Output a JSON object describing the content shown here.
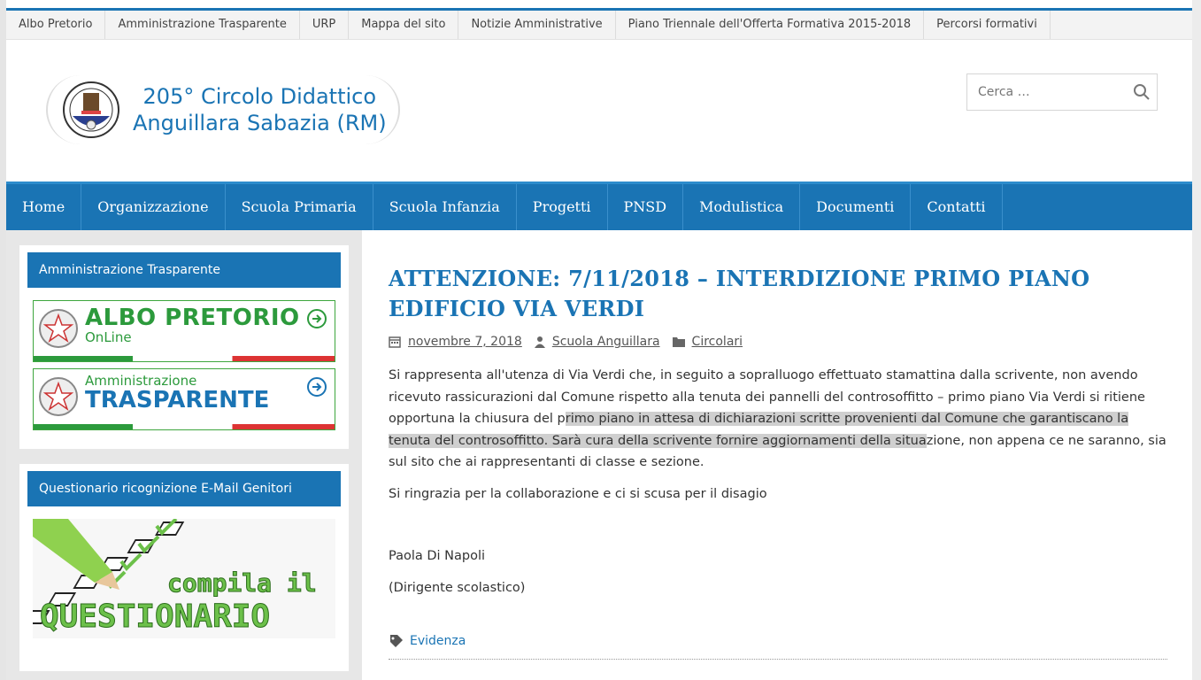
{
  "topnav": {
    "items": [
      "Albo Pretorio",
      "Amministrazione Trasparente",
      "URP",
      "Mappa del sito",
      "Notizie Amministrative",
      "Piano Triennale dell'Offerta Formativa 2015-2018",
      "Percorsi formativi"
    ]
  },
  "header": {
    "title_line1": "205° Circolo Didattico",
    "title_line2": "Anguillara Sabazia (RM)",
    "search_placeholder": "Cerca …"
  },
  "mainnav": {
    "items": [
      "Home",
      "Organizzazione",
      "Scuola Primaria",
      "Scuola Infanzia",
      "Progetti",
      "PNSD",
      "Modulistica",
      "Documenti",
      "Contatti"
    ]
  },
  "sidebar": {
    "widget1_title": "Amministrazione Trasparente",
    "albo_title": "ALBO PRETORIO",
    "albo_sub": "OnLine",
    "trasp_sub": "Amministrazione",
    "trasp_title": "TRASPARENTE",
    "widget2_title": "Questionario ricognizione E-Mail Genitori",
    "quest_line1": "compila il",
    "quest_line2": "QUESTIONARIO"
  },
  "post": {
    "title": "ATTENZIONE: 7/11/2018 – INTERDIZIONE PRIMO PIANO EDIFICIO VIA VERDI",
    "date": "novembre 7, 2018",
    "author": "Scuola Anguillara",
    "category": "Circolari",
    "para1_a": "Si rappresenta all'utenza di Via Verdi che, in seguito a sopralluogo effettuato stamattina dalla scrivente, non avendo ricevuto rassicurazioni dal Comune rispetto alla tenuta dei pannelli del controsoffitto – primo piano Via Verdi si ritiene opportuna la chiusura del p",
    "para1_hl": "rimo piano in attesa di dichiarazioni scritte provenienti dal Comune che garantiscano la tenuta del controsoffitto. Sarà cura della scrivente fornire aggiornamenti della situa",
    "para1_b": "zione, non appena ce ne saranno, sia sul sito che ai rappresentanti di classe e sezione.",
    "para2": "Si ringrazia per la collaborazione e ci si scusa per il disagio",
    "signature_name": "Paola Di Napoli",
    "signature_role": "(Dirigente scolastico)",
    "tag": "Evidenza"
  },
  "colors": {
    "brand_blue": "#1a74b4",
    "green": "#2c9a3c"
  }
}
